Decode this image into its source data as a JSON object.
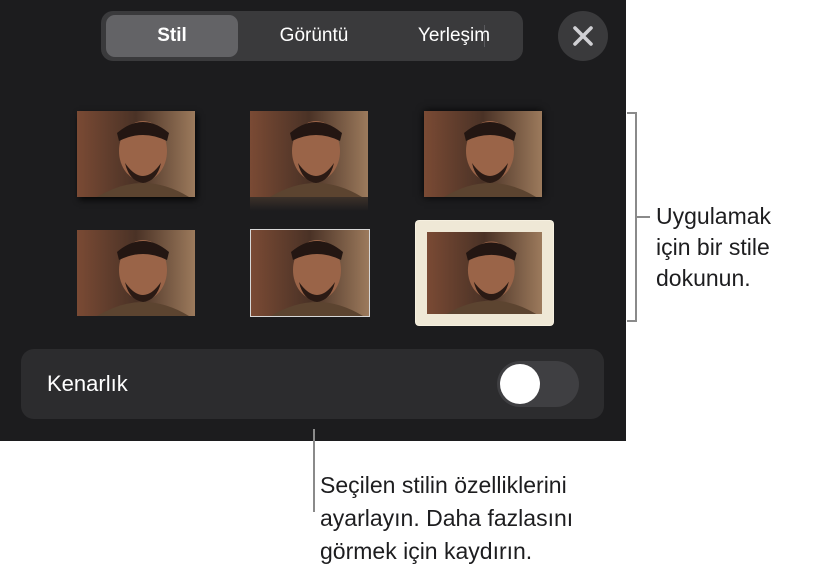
{
  "tabs": [
    {
      "label": "Stil",
      "active": true
    },
    {
      "label": "Görüntü",
      "active": false
    },
    {
      "label": "Yerleşim",
      "active": false
    }
  ],
  "close_icon": "close-icon",
  "styles": [
    {
      "name": "style-plain-shadow",
      "icon": "portrait-image"
    },
    {
      "name": "style-reflection",
      "icon": "portrait-image"
    },
    {
      "name": "style-drop-shadow",
      "icon": "portrait-image"
    },
    {
      "name": "style-plain",
      "icon": "portrait-image"
    },
    {
      "name": "style-thin-border",
      "icon": "portrait-image"
    },
    {
      "name": "style-picture-frame",
      "icon": "portrait-image"
    }
  ],
  "border": {
    "label": "Kenarlık",
    "enabled": false
  },
  "callouts": {
    "right": [
      "Uygulamak",
      "için bir stile",
      "dokunun."
    ],
    "bottom": [
      "Seçilen stilin özelliklerini",
      "ayarlayın. Daha fazlasını",
      "görmek için kaydırın."
    ]
  },
  "colors": {
    "panel": "#1c1c1e",
    "segment": "#3a3a3c",
    "active_segment": "#636366",
    "row": "#2c2c2e",
    "frame": "#efe8d6"
  }
}
